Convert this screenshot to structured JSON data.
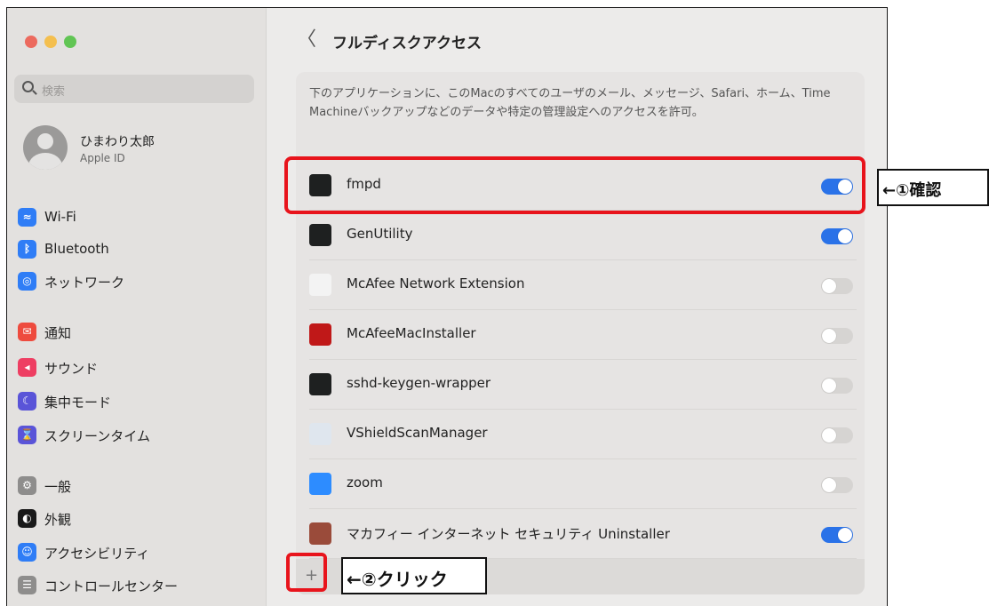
{
  "sidebar": {
    "search_placeholder": "検索",
    "account": {
      "name": "ひまわり太郎",
      "subtitle": "Apple ID"
    },
    "items": [
      {
        "label": "Wi-Fi",
        "icon": "wifi-icon",
        "color": "#2f7df6",
        "glyph": "≈"
      },
      {
        "label": "Bluetooth",
        "icon": "bluetooth-icon",
        "color": "#2f7df6",
        "glyph": "ᛒ"
      },
      {
        "label": "ネットワーク",
        "icon": "globe-icon",
        "color": "#2f7df6",
        "glyph": "◎"
      },
      {
        "label": "通知",
        "icon": "bell-icon",
        "color": "#ee4b3e",
        "glyph": "✉"
      },
      {
        "label": "サウンド",
        "icon": "speaker-icon",
        "color": "#ee3e62",
        "glyph": "◂"
      },
      {
        "label": "集中モード",
        "icon": "moon-icon",
        "color": "#5a54d8",
        "glyph": "☾"
      },
      {
        "label": "スクリーンタイム",
        "icon": "hourglass-icon",
        "color": "#5a54d8",
        "glyph": "⌛"
      },
      {
        "label": "一般",
        "icon": "gear-icon",
        "color": "#8e8d8c",
        "glyph": "⚙"
      },
      {
        "label": "外観",
        "icon": "appearance-icon",
        "color": "#1a1a1a",
        "glyph": "◐"
      },
      {
        "label": "アクセシビリティ",
        "icon": "accessibility-icon",
        "color": "#2f7df6",
        "glyph": "☺"
      },
      {
        "label": "コントロールセンター",
        "icon": "control-center-icon",
        "color": "#8e8d8c",
        "glyph": "☰"
      }
    ]
  },
  "main": {
    "back_glyph": "〈",
    "title": "フルディスクアクセス",
    "description": "下のアプリケーションに、このMacのすべてのユーザのメール、メッセージ、Safari、ホーム、Time Machineバックアップなどのデータや特定の管理設定へのアクセスを許可。",
    "apps": [
      {
        "name": "fmpd",
        "icon": "terminal-icon",
        "icon_color": "#1e2020",
        "enabled": true
      },
      {
        "name": "GenUtility",
        "icon": "terminal-icon",
        "icon_color": "#1e2020",
        "enabled": true
      },
      {
        "name": "McAfee Network Extension",
        "icon": "shield-icon",
        "icon_color": "#f3f3f3",
        "enabled": false
      },
      {
        "name": "McAfeeMacInstaller",
        "icon": "mcafee-icon",
        "icon_color": "#c01818",
        "enabled": false
      },
      {
        "name": "sshd-keygen-wrapper",
        "icon": "terminal-icon",
        "icon_color": "#1e2020",
        "enabled": false
      },
      {
        "name": "VShieldScanManager",
        "icon": "generic-app-icon",
        "icon_color": "#dfe6ee",
        "enabled": false
      },
      {
        "name": "zoom",
        "icon": "zoom-icon",
        "icon_color": "#2d8cff",
        "enabled": false
      },
      {
        "name": "マカフィー インターネット セキュリティ Uninstaller",
        "icon": "uninstaller-icon",
        "icon_color": "#9a4b3a",
        "enabled": true
      }
    ],
    "add_button": "+"
  },
  "annotations": {
    "confirm": "←①確認",
    "click": "←②クリック",
    "highlight_color": "#e8141c"
  }
}
